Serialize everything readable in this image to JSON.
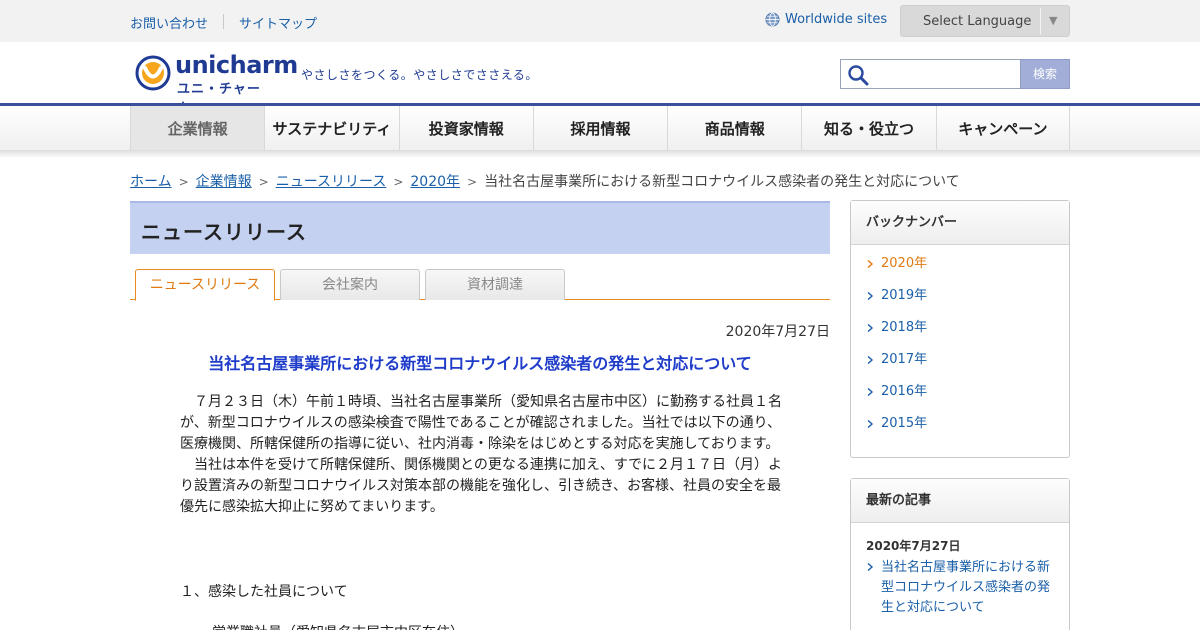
{
  "utility": {
    "contact": "お問い合わせ",
    "sitemap": "サイトマップ",
    "worldwide": "Worldwide sites",
    "language": "Select Language"
  },
  "header": {
    "logo_en": "unicharm",
    "logo_ja": "ユニ・チャーム",
    "tagline": "やさしさをつくる。やさしさでささえる。",
    "search_placeholder": "",
    "search_button": "検索"
  },
  "nav": [
    {
      "label": "企業情報",
      "active": true
    },
    {
      "label": "サステナビリティ"
    },
    {
      "label": "投資家情報"
    },
    {
      "label": "採用情報"
    },
    {
      "label": "商品情報"
    },
    {
      "label": "知る・役立つ"
    },
    {
      "label": "キャンペーン"
    }
  ],
  "breadcrumb": {
    "home": "ホーム",
    "corporate": "企業情報",
    "news": "ニュースリリース",
    "year": "2020年",
    "current": "当社名古屋事業所における新型コロナウイルス感染者の発生と対応について"
  },
  "main": {
    "heading": "ニュースリリース",
    "tabs": [
      "ニュースリリース",
      "会社案内",
      "資材調達"
    ],
    "date": "2020年7月27日",
    "title": "当社名古屋事業所における新型コロナウイルス感染者の発生と対応について",
    "paragraphs": [
      "　７月２３日（木）午前１時頃、当社名古屋事業所（愛知県名古屋市中区）に勤務する社員１名が、新型コロナウイルスの感染検査で陽性であることが確認されました。当社では以下の通り、医療機関、所轄保健所の指導に従い、社内消毒・除染をはじめとする対応を実施しております。",
      "　当社は本件を受けて所轄保健所、関係機関との更なる連携に加え、すでに２月１７日（月）より設置済みの新型コロナウイルス対策本部の機能を強化し、引き続き、お客様、社員の安全を最優先に感染拡大抑止に努めてまいります。"
    ],
    "section1": "１、感染した社員について",
    "section1_line": "営業職社員（愛知県名古屋市中区在住）"
  },
  "sidebar": {
    "back_numbers_title": "バックナンバー",
    "years": [
      "2020年",
      "2019年",
      "2018年",
      "2017年",
      "2016年",
      "2015年"
    ],
    "latest_title": "最新の記事",
    "latest_date": "2020年7月27日",
    "latest_link": "当社名古屋事業所における新型コロナウイルス感染者の発生と対応について"
  },
  "colors": {
    "brand_navy": "#1f3a93",
    "link_blue": "#1a5fa8",
    "title_blue": "#1e3cc9",
    "accent_orange": "#e07a10",
    "heading_bg": "#c5d1f0"
  }
}
